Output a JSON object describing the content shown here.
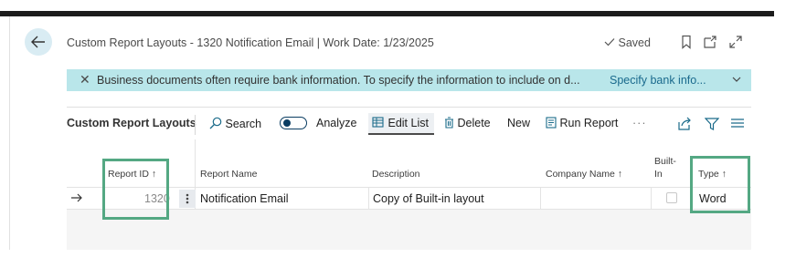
{
  "header": {
    "title": "Custom Report Layouts - 1320 Notification Email | Work Date: 1/23/2025",
    "saved_label": "Saved"
  },
  "banner": {
    "message": "Business documents often require bank information. To specify the information to include on d...",
    "link": "Specify bank info..."
  },
  "toolbar": {
    "page_name": "Custom Report Layouts",
    "search": "Search",
    "analyze": "Analyze",
    "edit_list": "Edit List",
    "delete": "Delete",
    "new": "New",
    "run_report": "Run Report",
    "more": "···"
  },
  "table": {
    "columns": {
      "report_id": "Report ID ↑",
      "report_name": "Report Name",
      "description": "Description",
      "company_name": "Company Name ↑",
      "built_in_1": "Built-",
      "built_in_2": "In",
      "type": "Type ↑"
    },
    "rows": [
      {
        "report_id": "1320",
        "report_name": "Notification Email",
        "description": "Copy of Built-in layout",
        "company_name": "",
        "built_in": false,
        "type": "Word"
      }
    ]
  },
  "colors": {
    "banner_bg": "#b9e6ea",
    "highlight": "#54a883",
    "accent_dark": "#0a3d62",
    "link": "#1a6a8d"
  },
  "icons": [
    "back-arrow-icon",
    "check-icon",
    "bookmark-icon",
    "open-new-icon",
    "expand-icon",
    "close-icon",
    "chevron-down-icon",
    "search-icon",
    "edit-list-icon",
    "delete-icon",
    "run-report-icon",
    "share-icon",
    "filter-icon",
    "list-icon",
    "row-arrow-icon",
    "more-vertical-icon"
  ]
}
